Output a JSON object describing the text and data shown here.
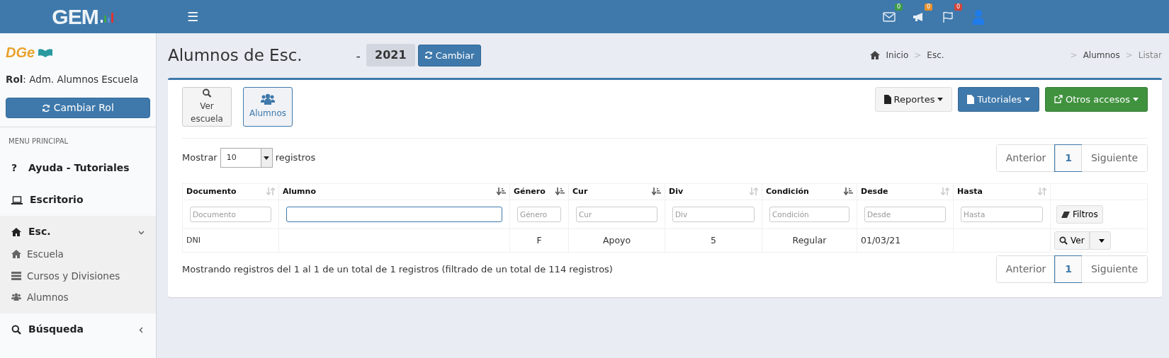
{
  "topbar": {
    "logo": "GEM",
    "menu_glyph": "☰",
    "notifications": [
      {
        "count": "0",
        "color": "#3c9a47"
      },
      {
        "count": "0",
        "color": "#e8912d"
      },
      {
        "count": "0",
        "color": "#d0433a"
      }
    ]
  },
  "sidebar": {
    "logo": "DGe",
    "role": "**Rol**: Adm. Alumnos Escuela",
    "change_role_button": "Cambiar Rol",
    "menu_header": "MENU PRINCIPAL",
    "items": [
      {
        "glyph": "?",
        "label": "Ayuda - Tutoriales"
      },
      {
        "label": "Escritorio"
      },
      {
        "label": "Esc.",
        "expanded": true,
        "children": [
          {
            "label": "Escuela"
          },
          {
            "label": "Cursos y Divisiones"
          },
          {
            "label": "Alumnos"
          }
        ]
      },
      {
        "label": "Búsqueda",
        "expanded": false
      }
    ]
  },
  "header": {
    "title": "Alumnos de Esc.",
    "separator": "-",
    "year": "2021",
    "change_button": "Cambiar",
    "breadcrumb": [
      {
        "label": "Inicio"
      },
      {
        "separator": ">",
        "label": "Esc."
      },
      {
        "separator": ">",
        "label": "Alumnos"
      },
      {
        "separator": ">",
        "label": "Listar"
      }
    ]
  },
  "toolbar": [
    {
      "label": "Ver escuela",
      "selected": false
    },
    {
      "label": "Alumnos",
      "selected": true
    }
  ],
  "actions": [
    {
      "label": "Reportes",
      "color": "#f4f4f4"
    },
    {
      "label": "Tutoriales",
      "color": "#3f79ab"
    },
    {
      "label": "Otros accesos",
      "color": "#40923f"
    }
  ],
  "length": {
    "prefix": "Mostrar",
    "value": "10",
    "suffix": "registros"
  },
  "pagination": [
    {
      "label": "Anterior",
      "selected": false
    },
    {
      "label": "1",
      "selected": true
    },
    {
      "label": "Siguiente",
      "selected": false
    }
  ],
  "table": {
    "columns": [
      {
        "label": "Documento",
        "sorted": false,
        "placeholder": "Documento"
      },
      {
        "label": "Alumno",
        "sorted": true,
        "focused": true
      },
      {
        "label": "Género",
        "sorted": true,
        "placeholder": "Género"
      },
      {
        "label": "Cur",
        "sorted": true,
        "placeholder": "Cur"
      },
      {
        "label": "Div",
        "sorted": false,
        "placeholder": "Div"
      },
      {
        "label": "Condición",
        "sorted": true,
        "placeholder": "Condición"
      },
      {
        "label": "Desde",
        "sorted": false,
        "placeholder": "Desde"
      },
      {
        "label": "Hasta",
        "sorted": false,
        "placeholder": "Hasta"
      }
    ],
    "filter_button": "Filtros",
    "rows": [
      {
        "cells": [
          "DNI",
          "",
          "F",
          "Apoyo",
          "5",
          "Regular",
          "01/03/21",
          ""
        ],
        "action": "Ver"
      }
    ]
  },
  "info": "Mostrando registros del 1 al 1 de un total de 1 registros (filtrado de un total de 114 registros)",
  "pagination_bottom": [
    {
      "label": "Anterior",
      "selected": false
    },
    {
      "label": "1",
      "selected": true
    },
    {
      "label": "Siguiente",
      "selected": false
    }
  ]
}
